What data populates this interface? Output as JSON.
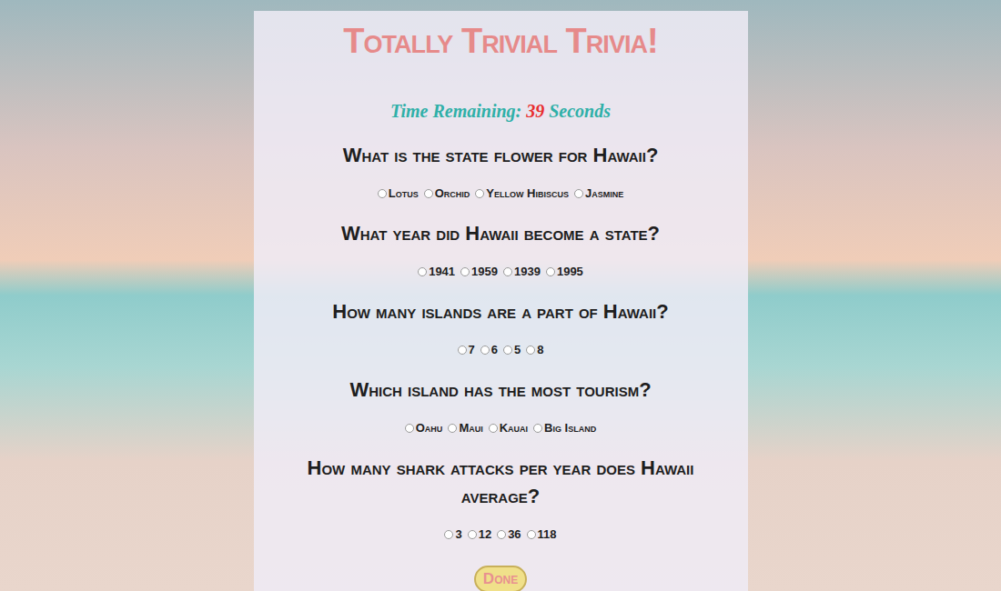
{
  "title": "Totally Trivial Trivia!",
  "timer": {
    "label": "Time Remaining:",
    "value": "39",
    "unit": "Seconds"
  },
  "questions": [
    {
      "text": "What is the state flower for Hawaii?",
      "options": [
        {
          "label": "Lotus",
          "selected": false
        },
        {
          "label": "Orchid",
          "selected": false
        },
        {
          "label": "Yellow Hibiscus",
          "selected": false
        },
        {
          "label": "Jasmine",
          "selected": false
        }
      ]
    },
    {
      "text": "What year did Hawaii become a state?",
      "options": [
        {
          "label": "1941",
          "selected": false
        },
        {
          "label": "1959",
          "selected": false
        },
        {
          "label": "1939",
          "selected": false
        },
        {
          "label": "1995",
          "selected": false
        }
      ]
    },
    {
      "text": "How many islands are a part of Hawaii?",
      "options": [
        {
          "label": "7",
          "selected": false
        },
        {
          "label": "6",
          "selected": false
        },
        {
          "label": "5",
          "selected": false
        },
        {
          "label": "8",
          "selected": false
        }
      ]
    },
    {
      "text": "Which island has the most tourism?",
      "options": [
        {
          "label": "Oahu",
          "selected": false
        },
        {
          "label": "Maui",
          "selected": false
        },
        {
          "label": "Kauai",
          "selected": false
        },
        {
          "label": "Big Island",
          "selected": false
        }
      ]
    },
    {
      "text": "How many shark attacks per year does Hawaii average?",
      "options": [
        {
          "label": "3",
          "selected": false
        },
        {
          "label": "12",
          "selected": false
        },
        {
          "label": "36",
          "selected": false
        },
        {
          "label": "118",
          "selected": false
        }
      ]
    }
  ],
  "done_button": "Done"
}
